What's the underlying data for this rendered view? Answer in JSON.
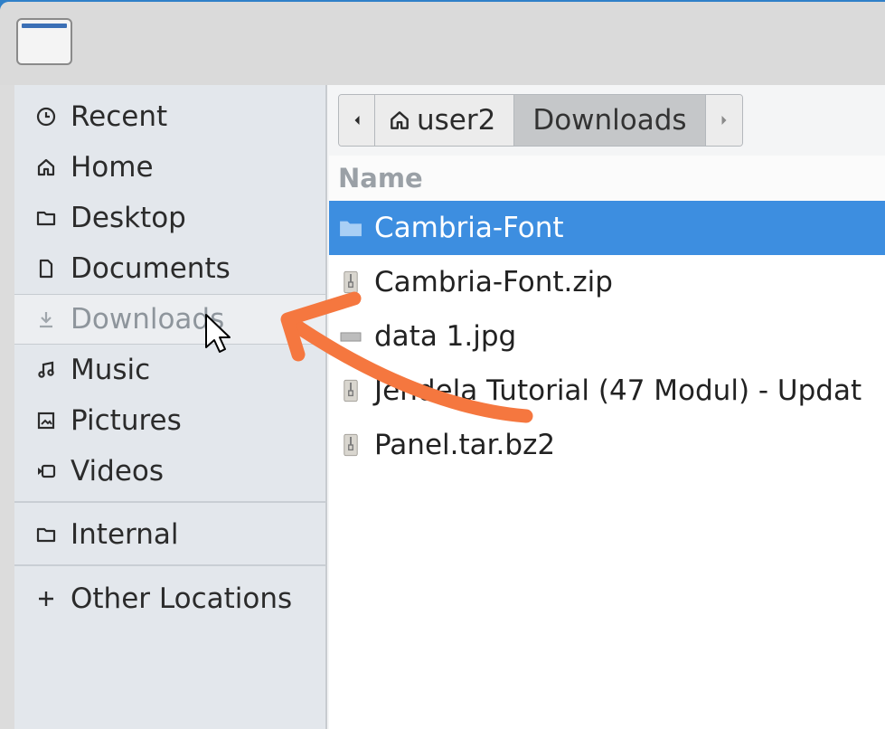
{
  "sidebar": {
    "items": [
      {
        "label": "Recent",
        "icon": "clock-icon"
      },
      {
        "label": "Home",
        "icon": "home-icon"
      },
      {
        "label": "Desktop",
        "icon": "folder-icon"
      },
      {
        "label": "Documents",
        "icon": "document-icon"
      },
      {
        "label": "Downloads",
        "icon": "download-icon"
      },
      {
        "label": "Music",
        "icon": "music-icon"
      },
      {
        "label": "Pictures",
        "icon": "image-icon"
      },
      {
        "label": "Videos",
        "icon": "video-icon"
      },
      {
        "label": "Internal",
        "icon": "folder-icon"
      },
      {
        "label": "Other Locations",
        "icon": "plus-icon"
      }
    ]
  },
  "pathbar": {
    "home": "user2",
    "current": "Downloads"
  },
  "filelist": {
    "column_name": "Name",
    "files": [
      {
        "name": "Cambria-Font",
        "icon": "folder-icon"
      },
      {
        "name": "Cambria-Font.zip",
        "icon": "archive-icon"
      },
      {
        "name": "data 1.jpg",
        "icon": "image-file-icon"
      },
      {
        "name": "Jendela Tutorial (47 Modul) - Updat",
        "icon": "archive-icon"
      },
      {
        "name": "Panel.tar.bz2",
        "icon": "archive-icon"
      }
    ]
  },
  "colors": {
    "selection": "#3d8ee0",
    "annotation_arrow": "#f5773f"
  }
}
